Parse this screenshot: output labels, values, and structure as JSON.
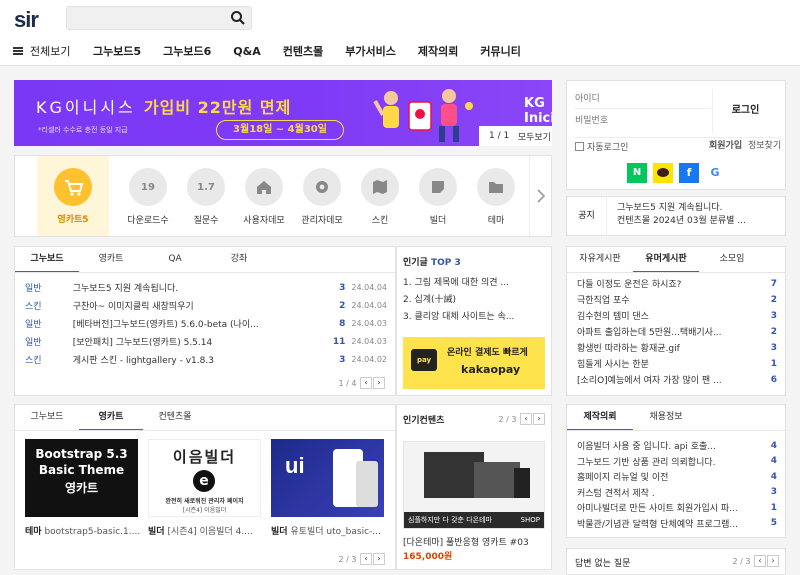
{
  "header": {
    "logo": "sir",
    "search_placeholder": ""
  },
  "nav": {
    "all": "전체보기",
    "items": [
      "그누보드5",
      "그누보드6",
      "Q&A",
      "컨텐츠몰",
      "부가서비스",
      "제작의뢰",
      "커뮤니티"
    ]
  },
  "banner": {
    "brand": "KG이니시스",
    "text": "가입비 22만원 면제",
    "sub": "*리셀러 수수료 충전 등일 지급",
    "period": "3월18일 ~ 4월30일",
    "kg_logo": "KG Inicis",
    "kg_sub": "",
    "counter": "1 / 1",
    "counter_btn": "모두보기"
  },
  "quick": {
    "items": [
      {
        "label": "영카트5",
        "badge": ""
      },
      {
        "label": "다운로드수",
        "badge": "19"
      },
      {
        "label": "질문수",
        "badge": "1.7"
      },
      {
        "label": "사용자데모",
        "badge": ""
      },
      {
        "label": "관리자데모",
        "badge": ""
      },
      {
        "label": "스킨",
        "badge": ""
      },
      {
        "label": "빌더",
        "badge": ""
      },
      {
        "label": "테마",
        "badge": ""
      }
    ]
  },
  "board": {
    "tabs": [
      "그누보드",
      "영카트",
      "QA",
      "강좌"
    ],
    "rows": [
      {
        "cat": "일반",
        "title": "그누보드5 지원 계속됩니다.",
        "n": "3",
        "date": "24.04.04"
      },
      {
        "cat": "스킨",
        "title": "구찬아~ 이미지클릭 새창띄우기",
        "n": "2",
        "date": "24.04.04"
      },
      {
        "cat": "일반",
        "title": "[베타버전]그누보드(영카트) 5.6.0-beta (나이...",
        "n": "8",
        "date": "24.04.03"
      },
      {
        "cat": "일반",
        "title": "[보안패치] 그누보드(영카트) 5.5.14",
        "n": "11",
        "date": "24.04.03"
      },
      {
        "cat": "스킨",
        "title": "게시판 스킨 - lightgallery - v1.8.3",
        "n": "3",
        "date": "24.04.02"
      }
    ],
    "pager": "1 / 4"
  },
  "popular": {
    "title": "인기글",
    "top": "TOP 3",
    "items": [
      "1. 그림 제목에 대한 의견 ...",
      "2. 십계(十誡)",
      "3. 클리앙 대체 사이트는 속..."
    ],
    "ad1": "온라인 결제도 빠르게",
    "ad2": "kakaopay",
    "ad_badge": "pay"
  },
  "login": {
    "id_placeholder": "아이디",
    "pw_placeholder": "비밀번호",
    "button": "로그인",
    "auto": "자동로그인",
    "join": "회원가입",
    "find": "정보찾기",
    "social": [
      "N",
      "G"
    ]
  },
  "notice": {
    "label": "공지",
    "items": [
      "그누보드5 지원 계속됩니다.",
      "컨텐츠몰 2024년 03월 분류별 ..."
    ]
  },
  "free": {
    "tabs": [
      "자유게시판",
      "유머게시판",
      "소모임"
    ],
    "rows": [
      {
        "t": "다들 이정도 운전은 하시죠?",
        "n": "7"
      },
      {
        "t": "극한직업 포수",
        "n": "2"
      },
      {
        "t": "김수현의 템미 댄스",
        "n": "3"
      },
      {
        "t": "아파트 출입하는데 5만원...택배기사...",
        "n": "2"
      },
      {
        "t": "황생빈 따라하는 황재균.gif",
        "n": "3"
      },
      {
        "t": "힘들게 사시는 한분",
        "n": "1"
      },
      {
        "t": "[소리O]예능에서 여자 가장 많이 팬 ...",
        "n": "6"
      }
    ]
  },
  "gallery": {
    "tabs": [
      "그누보드",
      "영카트",
      "컨텐츠몰"
    ],
    "items": [
      {
        "img_title": "Bootstrap 5.3",
        "img_sub": "Basic Theme",
        "img_sub2": "영카트",
        "cat": "테마",
        "title": "bootstrap5-basic.1...."
      },
      {
        "img_title": "이음빌더",
        "img_sub": "완전히 새로워진 관리자 페이지",
        "img_sub2": "[시즌4] 이음빌더",
        "cat": "빌더",
        "title": "[시즌4] 이음빌더 4...."
      },
      {
        "img_title": "",
        "img_sub": "",
        "img_sub2": "",
        "cat": "빌더",
        "title": "유토빌더 uto_basic-..."
      }
    ],
    "pager": "2 / 3"
  },
  "contents": {
    "title": "인기컨텐츠",
    "pager": "2 / 3",
    "img_caption": "심플하지만 다 갖춘 다온테마",
    "img_brand": "SHOP",
    "name": "[다온테마] 풀반응형 영카트 #03",
    "price": "165,000원"
  },
  "request": {
    "tabs": [
      "제작의뢰",
      "채용정보"
    ],
    "rows": [
      {
        "t": "이음빌더 사용 중 입니다. api 호출...",
        "n": "4"
      },
      {
        "t": "그누보드 기반 상품 관리 의뢰합니다.",
        "n": "4"
      },
      {
        "t": "홈페이지 리뉴얼 및 이전",
        "n": "4"
      },
      {
        "t": "커스텀 견적서 제작 .",
        "n": "3"
      },
      {
        "t": "아미나빌더로 만든 사이트 회원가입시 파...",
        "n": "1"
      },
      {
        "t": "박물관/기념관 달력형 단체예약 프로그램...",
        "n": "5"
      }
    ]
  },
  "unanswered": {
    "title": "답변 없는 질문",
    "pager": "2 / 3"
  },
  "colors": {
    "purple": "#7a38f5",
    "yellow": "#ffd845",
    "blue": "#3355aa",
    "naver": "#03c75a",
    "kakao": "#fee500",
    "facebook": "#1877f2"
  }
}
